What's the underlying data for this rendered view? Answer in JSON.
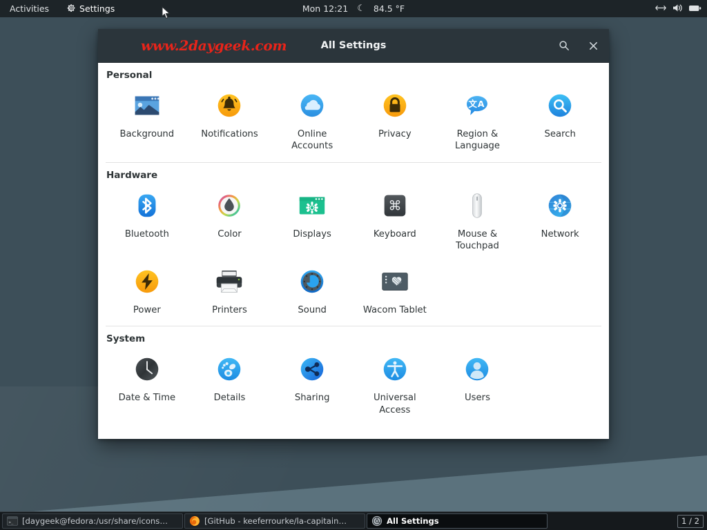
{
  "topbar": {
    "activities": "Activities",
    "app_name": "Settings",
    "app_icon": "gear-icon",
    "clock": "Mon 12:21",
    "weather_icon": "moon-icon",
    "temperature": "84.5 °F",
    "right_icons": [
      "network-arrows-icon",
      "volume-icon",
      "battery-icon"
    ]
  },
  "window": {
    "title": "All Settings",
    "watermark": "www.2daygeek.com",
    "watermark_color": "#e8241a",
    "titlebar_color": "#2b353b",
    "search_icon": "search-icon",
    "close_icon": "close-icon"
  },
  "sections": [
    {
      "title": "Personal",
      "items": [
        {
          "label": "Background",
          "icon": "background-icon"
        },
        {
          "label": "Notifications",
          "icon": "notifications-icon"
        },
        {
          "label": "Online Accounts",
          "icon": "online-accounts-icon"
        },
        {
          "label": "Privacy",
          "icon": "privacy-icon"
        },
        {
          "label": "Region & Language",
          "icon": "region-language-icon"
        },
        {
          "label": "Search",
          "icon": "search-panel-icon"
        }
      ]
    },
    {
      "title": "Hardware",
      "items": [
        {
          "label": "Bluetooth",
          "icon": "bluetooth-icon"
        },
        {
          "label": "Color",
          "icon": "color-icon"
        },
        {
          "label": "Displays",
          "icon": "displays-icon"
        },
        {
          "label": "Keyboard",
          "icon": "keyboard-icon"
        },
        {
          "label": "Mouse & Touchpad",
          "icon": "mouse-touchpad-icon"
        },
        {
          "label": "Network",
          "icon": "network-icon"
        },
        {
          "label": "Power",
          "icon": "power-icon"
        },
        {
          "label": "Printers",
          "icon": "printers-icon"
        },
        {
          "label": "Sound",
          "icon": "sound-icon"
        },
        {
          "label": "Wacom Tablet",
          "icon": "wacom-tablet-icon"
        }
      ]
    },
    {
      "title": "System",
      "items": [
        {
          "label": "Date & Time",
          "icon": "date-time-icon"
        },
        {
          "label": "Details",
          "icon": "details-icon"
        },
        {
          "label": "Sharing",
          "icon": "sharing-icon"
        },
        {
          "label": "Universal Access",
          "icon": "universal-access-icon"
        },
        {
          "label": "Users",
          "icon": "users-icon"
        }
      ]
    }
  ],
  "taskbar": {
    "tasks": [
      {
        "label": "[daygeek@fedora:/usr/share/icons…",
        "icon": "terminal-icon",
        "active": false
      },
      {
        "label": "[GitHub - keeferrourke/la-capitain…",
        "icon": "firefox-icon",
        "active": false
      },
      {
        "label": "All Settings",
        "icon": "settings-icon",
        "active": true
      }
    ],
    "workspace": "1 / 2"
  }
}
